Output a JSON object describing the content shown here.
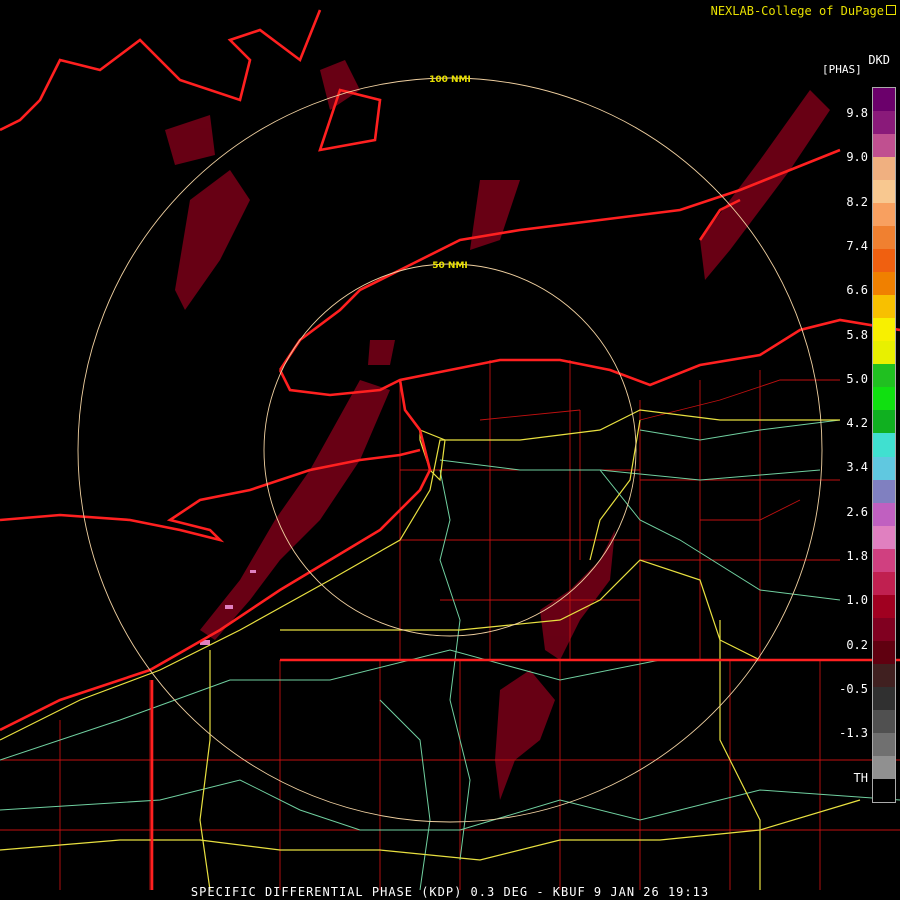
{
  "credit": "NEXLAB-College of DuPage",
  "product_title": "SPECIFIC DIFFERENTIAL PHASE (KDP) 0.3 DEG - KBUF 9 JAN 26 19:13",
  "legend": {
    "code": "DKD",
    "unit": "[PHAS]",
    "ticks": [
      "9.8",
      "9.0",
      "8.2",
      "7.4",
      "6.6",
      "5.8",
      "5.0",
      "4.2",
      "3.4",
      "2.6",
      "1.8",
      "1.0",
      "0.2",
      "-0.5",
      "-1.3",
      "TH"
    ],
    "colors": [
      "#6b006b",
      "#8a1a7a",
      "#c05090",
      "#f0b080",
      "#f8c890",
      "#f8a060",
      "#f08030",
      "#f06010",
      "#f08000",
      "#f8c000",
      "#f8f000",
      "#e8f000",
      "#20c020",
      "#10e010",
      "#10b020",
      "#40e0d0",
      "#60c8e0",
      "#8080c0",
      "#c060c0",
      "#e080c0",
      "#d04080",
      "#c02050",
      "#a00020",
      "#800020",
      "#600010",
      "#402020",
      "#303030",
      "#505050",
      "#707070",
      "#909090",
      "#000000"
    ]
  },
  "range_rings": [
    {
      "label": "100 NMI",
      "radius_nmi": 100
    },
    {
      "label": "50 NMI",
      "radius_nmi": 50
    }
  ],
  "map_colors": {
    "border": "#ff2020",
    "county": "#c01010",
    "highway": "#e8e040",
    "road": "#70d0a0",
    "ring": "#f0d0a0",
    "echo": "#7a0018"
  },
  "icons": [
    "zoom-corner-icon"
  ]
}
